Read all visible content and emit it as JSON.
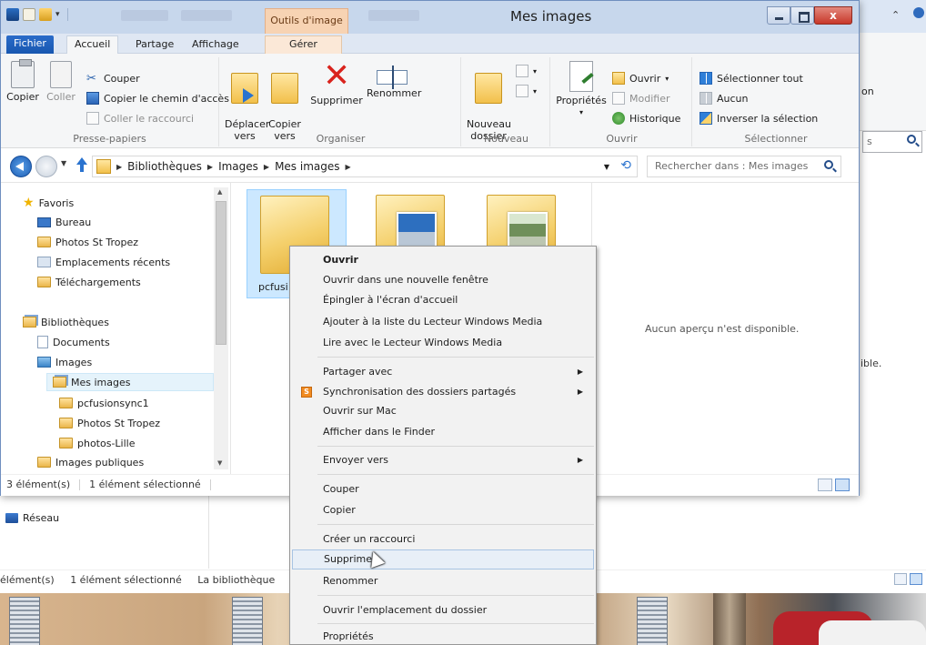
{
  "window": {
    "title": "Mes images",
    "contextual_tab_title": "Outils d'image",
    "close_glyph": "x"
  },
  "tabs": {
    "file": "Fichier",
    "items": [
      "Accueil",
      "Partage",
      "Affichage"
    ],
    "contextual": "Gérer"
  },
  "ribbon": {
    "clipboard": {
      "copy": "Copier",
      "paste": "Coller",
      "cut": "Couper",
      "copy_path": "Copier le chemin d'accès",
      "paste_shortcut": "Coller le raccourci",
      "label": "Presse-papiers"
    },
    "organize": {
      "move_to": "Déplacer\nvers",
      "copy_to": "Copier\nvers",
      "delete": "Supprimer",
      "rename": "Renommer",
      "label": "Organiser"
    },
    "new": {
      "new_folder": "Nouveau\ndossier",
      "label": "Nouveau"
    },
    "open": {
      "properties": "Propriétés",
      "open": "Ouvrir",
      "edit": "Modifier",
      "history": "Historique",
      "label": "Ouvrir"
    },
    "select": {
      "select_all": "Sélectionner tout",
      "select_none": "Aucun",
      "invert": "Inverser la sélection",
      "label": "Sélectionner"
    }
  },
  "address": {
    "crumbs": [
      "Bibliothèques",
      "Images",
      "Mes images"
    ],
    "search_placeholder": "Rechercher dans : Mes images"
  },
  "nav": {
    "favorites": "Favoris",
    "bureau": "Bureau",
    "photos_st_tropez": "Photos St Tropez",
    "recent": "Emplacements récents",
    "downloads": "Téléchargements",
    "libraries": "Bibliothèques",
    "documents": "Documents",
    "images": "Images",
    "my_images": "Mes images",
    "pcfusionsync1": "pcfusionsync1",
    "photos_st_tropez_sub": "Photos St Tropez",
    "photos_lille": "photos-Lille",
    "public_images": "Images publiques"
  },
  "content": {
    "tiles": [
      {
        "label": "pcfusi"
      },
      {
        "label": ""
      },
      {
        "label": ""
      }
    ],
    "preview_text": "Aucun aperçu n'est disponible."
  },
  "status": {
    "count": "3 élément(s)",
    "selected": "1 élément sélectionné"
  },
  "background": {
    "ribbon_fragment": "on",
    "search_fragment": "s",
    "preview_fragment": "ible.",
    "network": "Réseau",
    "status_count": "élément(s)",
    "status_selected": "1 élément sélectionné",
    "status_library": "La bibliothèque"
  },
  "context_menu": {
    "items": [
      "Ouvrir",
      "Ouvrir dans une nouvelle fenêtre",
      "Épingler à l'écran d'accueil",
      "Ajouter à la liste du Lecteur Windows Media",
      "Lire avec le Lecteur Windows Media",
      "Partager avec",
      "Synchronisation des dossiers partagés",
      "Ouvrir sur Mac",
      "Afficher dans le Finder",
      "Envoyer vers",
      "Couper",
      "Copier",
      "Créer un raccourci",
      "Supprimer",
      "Renommer",
      "Ouvrir l'emplacement du dossier",
      "Propriétés"
    ],
    "submenu_glyph": "▶",
    "sync_icon_glyph": "S"
  }
}
